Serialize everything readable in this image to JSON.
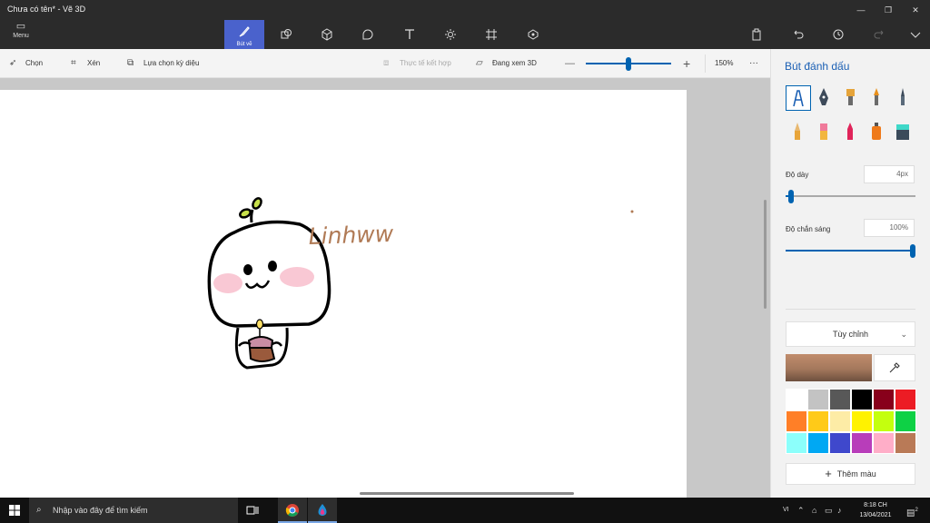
{
  "window": {
    "title": "Chưa có tên* - Vẽ 3D",
    "minimize_icon": "minimize-icon",
    "maximize_icon": "restore-icon",
    "close_icon": "close-icon"
  },
  "toolbar": {
    "menu_label": "Menu",
    "active_tool_label": "Bút vẽ",
    "tools": [
      "brush",
      "2d-shapes",
      "3d-shapes",
      "stickers",
      "text",
      "effects",
      "canvas",
      "3d-library"
    ],
    "right_tools": [
      "paste",
      "undo",
      "history",
      "redo",
      "expand"
    ]
  },
  "subbar": {
    "select_label": "Chọn",
    "crop_label": "Xén",
    "magic_select_label": "Lựa chọn kỳ diệu",
    "mixed_reality_label": "Thực tế kết hợp",
    "view_3d_label": "Đang xem 3D",
    "zoom_value": "150%",
    "zoom_level": 0.5,
    "more_label": "···"
  },
  "canvas": {
    "handwriting": "Linhww",
    "accent_color": "#b07a55"
  },
  "panel": {
    "title": "Bút đánh dấu",
    "thickness_label": "Độ dày",
    "thickness_value": "4px",
    "thickness_level": 0.04,
    "opacity_label": "Độ chắn sáng",
    "opacity_value": "100%",
    "opacity_level": 1.0,
    "texture_dropdown": "Tùy chỉnh",
    "current_color": "#a4785c",
    "add_color_label": "Thêm màu",
    "brushes": [
      "marker",
      "calligraphy-pen",
      "oil-brush",
      "watercolor",
      "pixel-pen",
      "pencil",
      "eraser",
      "crayon",
      "spray-can",
      "fill-bucket"
    ],
    "palette": [
      "#ffffff",
      "#c3c3c3",
      "#585858",
      "#000000",
      "#88001b",
      "#ec1c24",
      "#ff7f27",
      "#ffca18",
      "#fdeca6",
      "#fff200",
      "#c4ff0e",
      "#0ed145",
      "#8cfffb",
      "#00a8f3",
      "#3f48cc",
      "#b83dba",
      "#ffaec8",
      "#b97a57"
    ]
  },
  "taskbar": {
    "search_placeholder": "Nhập vào đây để tìm kiếm",
    "language": "VI",
    "time": "8:18 CH",
    "date": "13/04/2021",
    "notification_count": "2"
  }
}
